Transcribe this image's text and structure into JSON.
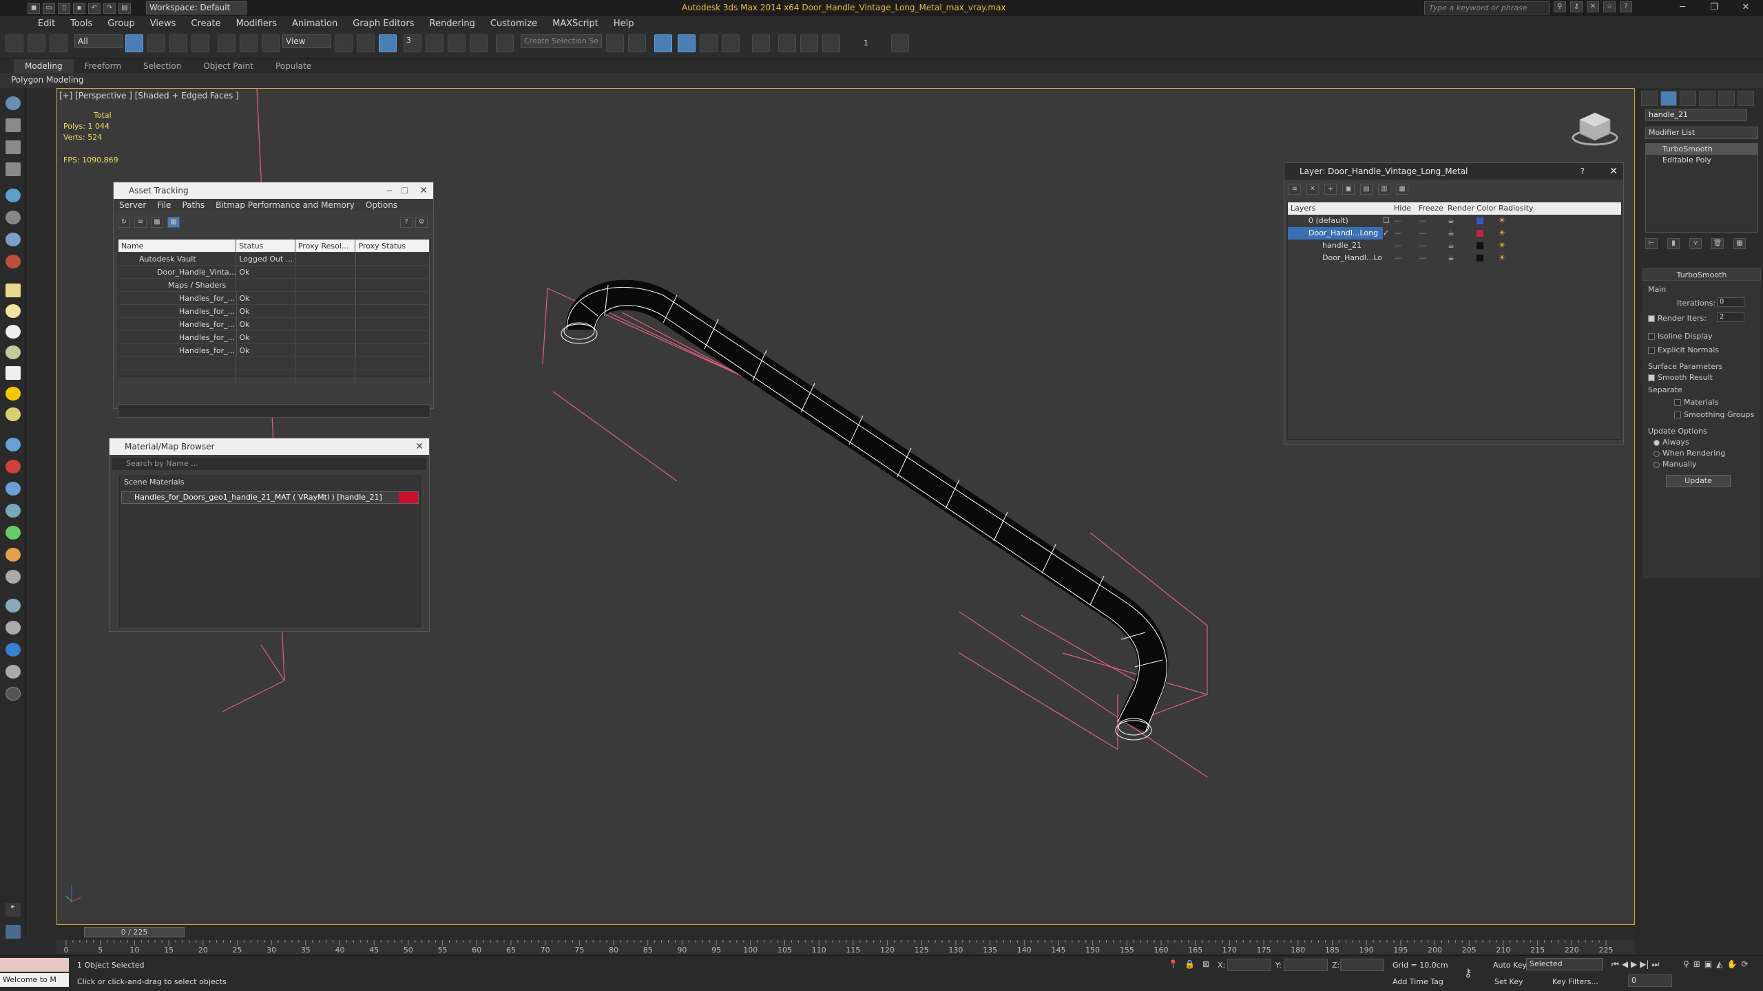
{
  "titlebar": {
    "title": "Autodesk 3ds Max 2014 x64    Door_Handle_Vintage_Long_Metal_max_vray.max",
    "workspace": "Workspace: Default",
    "search_placeholder": "Type a keyword or phrase"
  },
  "menubar": {
    "items": [
      "Edit",
      "Tools",
      "Group",
      "Views",
      "Create",
      "Modifiers",
      "Animation",
      "Graph Editors",
      "Rendering",
      "Customize",
      "MAXScript",
      "Help"
    ]
  },
  "toolbar": {
    "selection_filter": "All",
    "ref_coord": "View",
    "named_selection": "Create Selection Se",
    "snaps": "3",
    "spinner_snap": "1"
  },
  "ribbon": {
    "tabs": [
      "Modeling",
      "Freeform",
      "Selection",
      "Object Paint",
      "Populate"
    ],
    "active": "Modeling",
    "sub_label": "Polygon Modeling"
  },
  "viewport": {
    "label": "[+] [Perspective ] [Shaded + Edged Faces ]",
    "stats_total": "Total",
    "polys": "Polys:  1 044",
    "verts": "Verts:  524",
    "fps": "FPS:     1090,869"
  },
  "asset_tracking": {
    "title": "Asset Tracking",
    "menu": [
      "Server",
      "File",
      "Paths",
      "Bitmap Performance and Memory",
      "Options"
    ],
    "columns": [
      "Name",
      "Status",
      "Proxy Resol...",
      "Proxy Status"
    ],
    "rows": [
      [
        "Autodesk Vault",
        "Logged Out ...",
        "",
        ""
      ],
      [
        "Door_Handle_Vinta...",
        "Ok",
        "",
        ""
      ],
      [
        "Maps / Shaders",
        "",
        "",
        ""
      ],
      [
        "Handles_for_...",
        "Ok",
        "",
        ""
      ],
      [
        "Handles_for_...",
        "Ok",
        "",
        ""
      ],
      [
        "Handles_for_...",
        "Ok",
        "",
        ""
      ],
      [
        "Handles_for_...",
        "Ok",
        "",
        ""
      ],
      [
        "Handles_for_...",
        "Ok",
        "",
        ""
      ]
    ]
  },
  "material_browser": {
    "title": "Material/Map Browser",
    "search": "Search by Name ...",
    "section": "Scene Materials",
    "item": "Handles_for_Doors_geo1_handle_21_MAT ( VRayMtl ) [handle_21]"
  },
  "layer_dialog": {
    "title": "Layer: Door_Handle_Vintage_Long_Metal",
    "help": "?",
    "columns": [
      "Layers",
      "Hide",
      "Freeze",
      "Render",
      "Color",
      "Radiosity"
    ],
    "rows": [
      {
        "name": "0 (default)",
        "color": "#3a56c8"
      },
      {
        "name": "Door_Handl...Long",
        "color": "#c8204a"
      },
      {
        "name": "handle_21",
        "color": "#101010"
      },
      {
        "name": "Door_Handl...Lo",
        "color": "#101010"
      }
    ]
  },
  "command_panel": {
    "object_name": "handle_21",
    "modifier_list": "Modifier List",
    "stack": [
      "TurboSmooth",
      "Editable Poly"
    ],
    "rollout_title": "TurboSmooth",
    "main": "Main",
    "iterations_label": "Iterations:",
    "iterations": "0",
    "render_iters_label": "Render Iters:",
    "render_iters": "2",
    "isoline": "Isoline Display",
    "explicit": "Explicit Normals",
    "surface": "Surface Parameters",
    "smooth_result": "Smooth Result",
    "separate": "Separate",
    "materials": "Materials",
    "smoothing_groups": "Smoothing Groups",
    "update_options": "Update Options",
    "always": "Always",
    "when_rendering": "When Rendering",
    "manually": "Manually",
    "update_btn": "Update"
  },
  "timeline": {
    "frame": "0 / 225",
    "ticks": [
      "0",
      "5",
      "10",
      "15",
      "20",
      "25",
      "30",
      "35",
      "40",
      "45",
      "50",
      "55",
      "60",
      "65",
      "70",
      "75",
      "80",
      "85",
      "90",
      "95",
      "100",
      "105",
      "110",
      "115",
      "120",
      "125",
      "130",
      "135",
      "140",
      "145",
      "150",
      "155",
      "160",
      "165",
      "170",
      "175",
      "180",
      "185",
      "190",
      "195",
      "200",
      "205",
      "210",
      "215",
      "220",
      "225"
    ]
  },
  "status": {
    "maxscript": "Welcome to M",
    "selected": "1 Object Selected",
    "prompt": "Click or click-and-drag to select objects",
    "x": "X:",
    "y": "Y:",
    "z": "Z:",
    "grid": "Grid = 10,0cm",
    "add_time_tag": "Add Time Tag",
    "auto_key": "Auto Key",
    "set_key": "Set Key",
    "selected_dd": "Selected",
    "key_filters": "Key Filters...",
    "frame_value": "0"
  }
}
